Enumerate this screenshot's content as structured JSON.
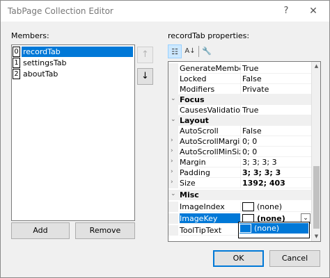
{
  "window": {
    "title": "TabPage Collection Editor",
    "help_glyph": "?",
    "close_glyph": "✕"
  },
  "members": {
    "label": "Members:",
    "items": [
      {
        "index": "0",
        "label": "recordTab",
        "selected": true
      },
      {
        "index": "1",
        "label": "settingsTab",
        "selected": false
      },
      {
        "index": "2",
        "label": "aboutTab",
        "selected": false
      }
    ],
    "move_up_glyph": "↑",
    "move_down_glyph": "↓"
  },
  "buttons": {
    "add": "Add",
    "remove": "Remove",
    "ok": "OK",
    "cancel": "Cancel"
  },
  "properties": {
    "label": "recordTab properties:",
    "toolbar": {
      "categorized_glyph": "☷",
      "alphabetical_glyph": "A↓",
      "property_pages_glyph": "🔧"
    },
    "rows": {
      "r0": {
        "name": "GenerateMember",
        "value": "True"
      },
      "r1": {
        "name": "Locked",
        "value": "False"
      },
      "r2": {
        "name": "Modifiers",
        "value": "Private"
      },
      "focus": {
        "name": "Focus",
        "expander": "⌄"
      },
      "r3": {
        "name": "CausesValidation",
        "value": "True"
      },
      "layout": {
        "name": "Layout",
        "expander": "⌄"
      },
      "r4": {
        "name": "AutoScroll",
        "value": "False"
      },
      "r5": {
        "name": "AutoScrollMargin",
        "value": "0; 0",
        "expander": "›"
      },
      "r6": {
        "name": "AutoScrollMinSize",
        "value": "0; 0",
        "expander": "›"
      },
      "r7": {
        "name": "Margin",
        "value": "3; 3; 3; 3",
        "expander": "›"
      },
      "r8": {
        "name": "Padding",
        "value": "3; 3; 3; 3",
        "expander": "›"
      },
      "r9": {
        "name": "Size",
        "value": "1392; 403",
        "expander": "›"
      },
      "misc": {
        "name": "Misc",
        "expander": "⌄"
      },
      "r10": {
        "name": "ImageIndex",
        "value": "(none)"
      },
      "r11": {
        "name": "ImageKey",
        "value": "(none)"
      },
      "r12": {
        "name": "ToolTipText",
        "value": ""
      }
    },
    "dropdown": {
      "arrow_glyph": "⌄",
      "option": "(none)"
    },
    "scroll": {
      "up_glyph": "▲",
      "down_glyph": "▼"
    }
  }
}
